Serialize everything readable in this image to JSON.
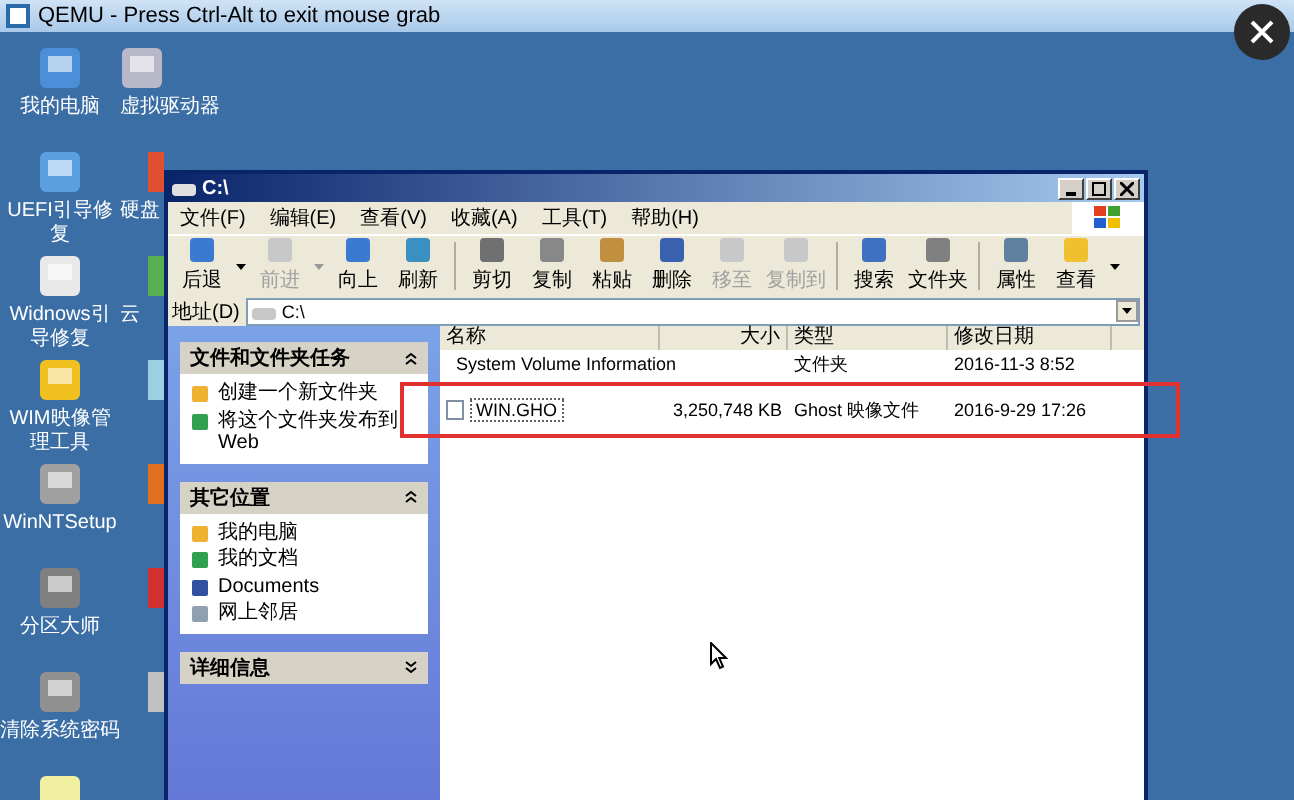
{
  "host_window": {
    "title": "QEMU - Press Ctrl-Alt to exit mouse grab"
  },
  "desktop_icons": [
    {
      "label": "我的电脑"
    },
    {
      "label": "UEFI引导修复"
    },
    {
      "label": "Widnows引导修复"
    },
    {
      "label": "WIM映像管理工具"
    },
    {
      "label": "WinNTSetup"
    },
    {
      "label": "分区大师"
    },
    {
      "label": "清除系统密码"
    }
  ],
  "desktop_icons_2": [
    {
      "label": "虚拟驱动器"
    },
    {
      "label": "硬盘"
    },
    {
      "label": "云"
    }
  ],
  "explorer": {
    "title": "C:\\",
    "menu": [
      "文件(F)",
      "编辑(E)",
      "查看(V)",
      "收藏(A)",
      "工具(T)",
      "帮助(H)"
    ],
    "toolbar": [
      {
        "label": "后退",
        "disabled": false,
        "dropdown": true
      },
      {
        "label": "前进",
        "disabled": true,
        "dropdown": true
      },
      {
        "label": "向上",
        "disabled": false,
        "dropdown": false
      },
      {
        "label": "刷新",
        "disabled": false,
        "dropdown": false
      },
      {
        "label": "剪切",
        "disabled": false,
        "dropdown": false
      },
      {
        "label": "复制",
        "disabled": false,
        "dropdown": false
      },
      {
        "label": "粘贴",
        "disabled": false,
        "dropdown": false
      },
      {
        "label": "删除",
        "disabled": false,
        "dropdown": false
      },
      {
        "label": "移至",
        "disabled": true,
        "dropdown": false
      },
      {
        "label": "复制到",
        "disabled": true,
        "dropdown": false
      },
      {
        "label": "搜索",
        "disabled": false,
        "dropdown": false
      },
      {
        "label": "文件夹",
        "disabled": false,
        "dropdown": false
      },
      {
        "label": "属性",
        "disabled": false,
        "dropdown": false
      },
      {
        "label": "查看",
        "disabled": false,
        "dropdown": true
      }
    ],
    "address": {
      "label": "地址(D)",
      "value": "C:\\"
    },
    "panels": [
      {
        "title": "文件和文件夹任务",
        "expanded": true,
        "items": [
          "创建一个新文件夹",
          "将这个文件夹发布到 Web"
        ]
      },
      {
        "title": "其它位置",
        "expanded": true,
        "items": [
          "我的电脑",
          "我的文档",
          "Documents",
          "网上邻居"
        ]
      },
      {
        "title": "详细信息",
        "expanded": false
      }
    ],
    "columns": [
      "名称",
      "大小",
      "类型",
      "修改日期"
    ],
    "files": [
      {
        "name": "System Volume Information",
        "type": "文件夹",
        "modified": "2016-11-3 8:52",
        "selected": false,
        "highlighted": false
      },
      {
        "name": "WIN.GHO",
        "size": "3,250,748 KB",
        "type": "Ghost 映像文件",
        "modified": "2016-9-29 17:26",
        "selected": true,
        "highlighted": true
      }
    ]
  }
}
